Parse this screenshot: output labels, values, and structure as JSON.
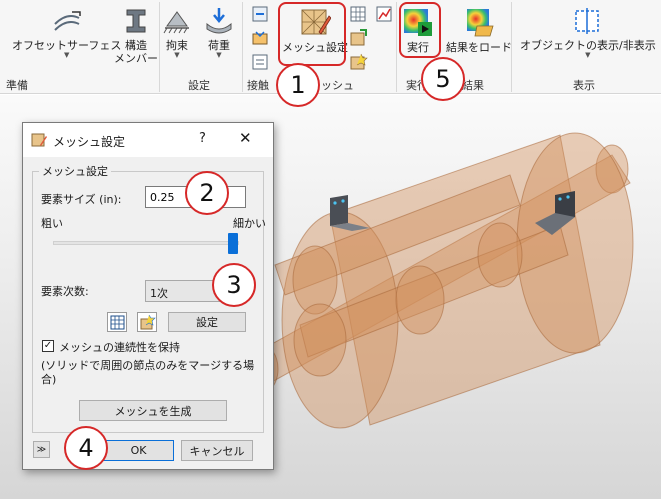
{
  "ribbon": {
    "offset_surface": "オフセットサーフェス",
    "structural_member": "構造\nメンバー",
    "constraint": "拘束",
    "load": "荷重",
    "mesh_settings": "メッシュ設定",
    "run": "実行",
    "load_results": "結果をロード",
    "show_hide_objects": "オブジェクトの表示/非表示",
    "groups": {
      "prepare": "準備",
      "setup": "設定",
      "contact": "接触",
      "mesh": "メッシュ",
      "solve": "実行",
      "results": "結果",
      "display": "表示"
    }
  },
  "callouts": {
    "one": "1",
    "two": "2",
    "three": "3",
    "four": "4",
    "five": "5"
  },
  "dialog": {
    "title": "メッシュ設定",
    "help": "?",
    "close": "✕",
    "group_title": "メッシュ設定",
    "element_size_label": "要素サイズ (in):",
    "element_size_value": "0.25",
    "coarse_label": "粗い",
    "fine_label": "細かい",
    "element_order_label": "要素次数:",
    "element_order_value": "1次",
    "settings_button": "設定",
    "keep_continuity_label": "メッシュの連続性を保持",
    "continuity_note": "(ソリッドで周囲の節点のみをマージする場合)",
    "generate_mesh_button": "メッシュを生成",
    "ok_button": "OK",
    "cancel_button": "キャンセル",
    "expand_icon": "≫"
  },
  "colors": {
    "callout_red": "#d62828",
    "model_orange": "#d2905a",
    "slider_blue": "#0a6fd8"
  }
}
